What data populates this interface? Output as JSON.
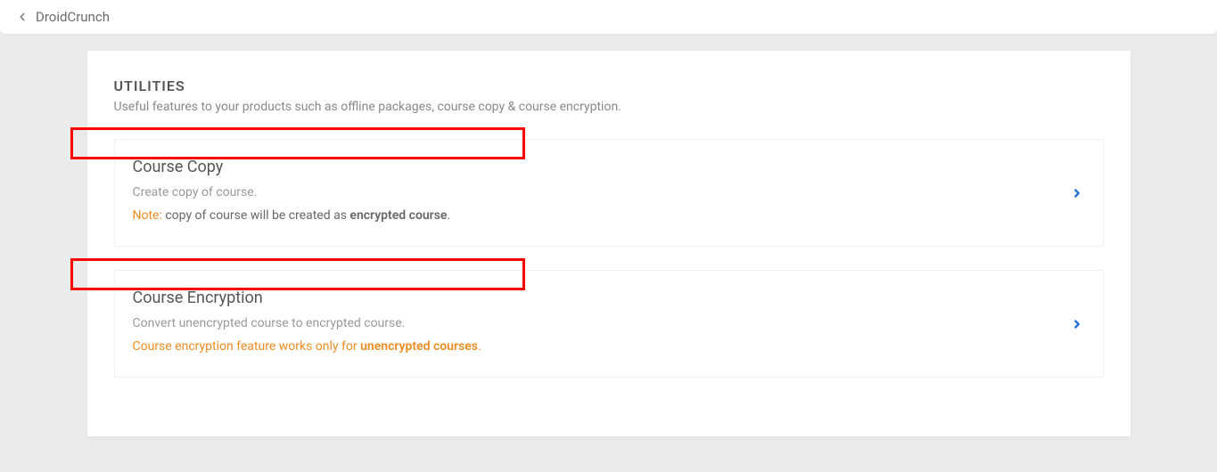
{
  "topbar": {
    "back_title": "DroidCrunch"
  },
  "section": {
    "title": "UTILITIES",
    "description": "Useful features to your products such as offline packages, course copy & course encryption."
  },
  "cards": {
    "copy": {
      "title": "Course Copy",
      "subtitle": "Create copy of course.",
      "note_label": "Note:",
      "note_mid": " copy of course will be created as ",
      "note_bold": "encrypted course",
      "note_end": "."
    },
    "encryption": {
      "title": "Course Encryption",
      "subtitle": "Convert unencrypted course to encrypted course.",
      "note_pre": "Course encryption feature works only for ",
      "note_bold": "unencrypted courses",
      "note_end": "."
    }
  }
}
